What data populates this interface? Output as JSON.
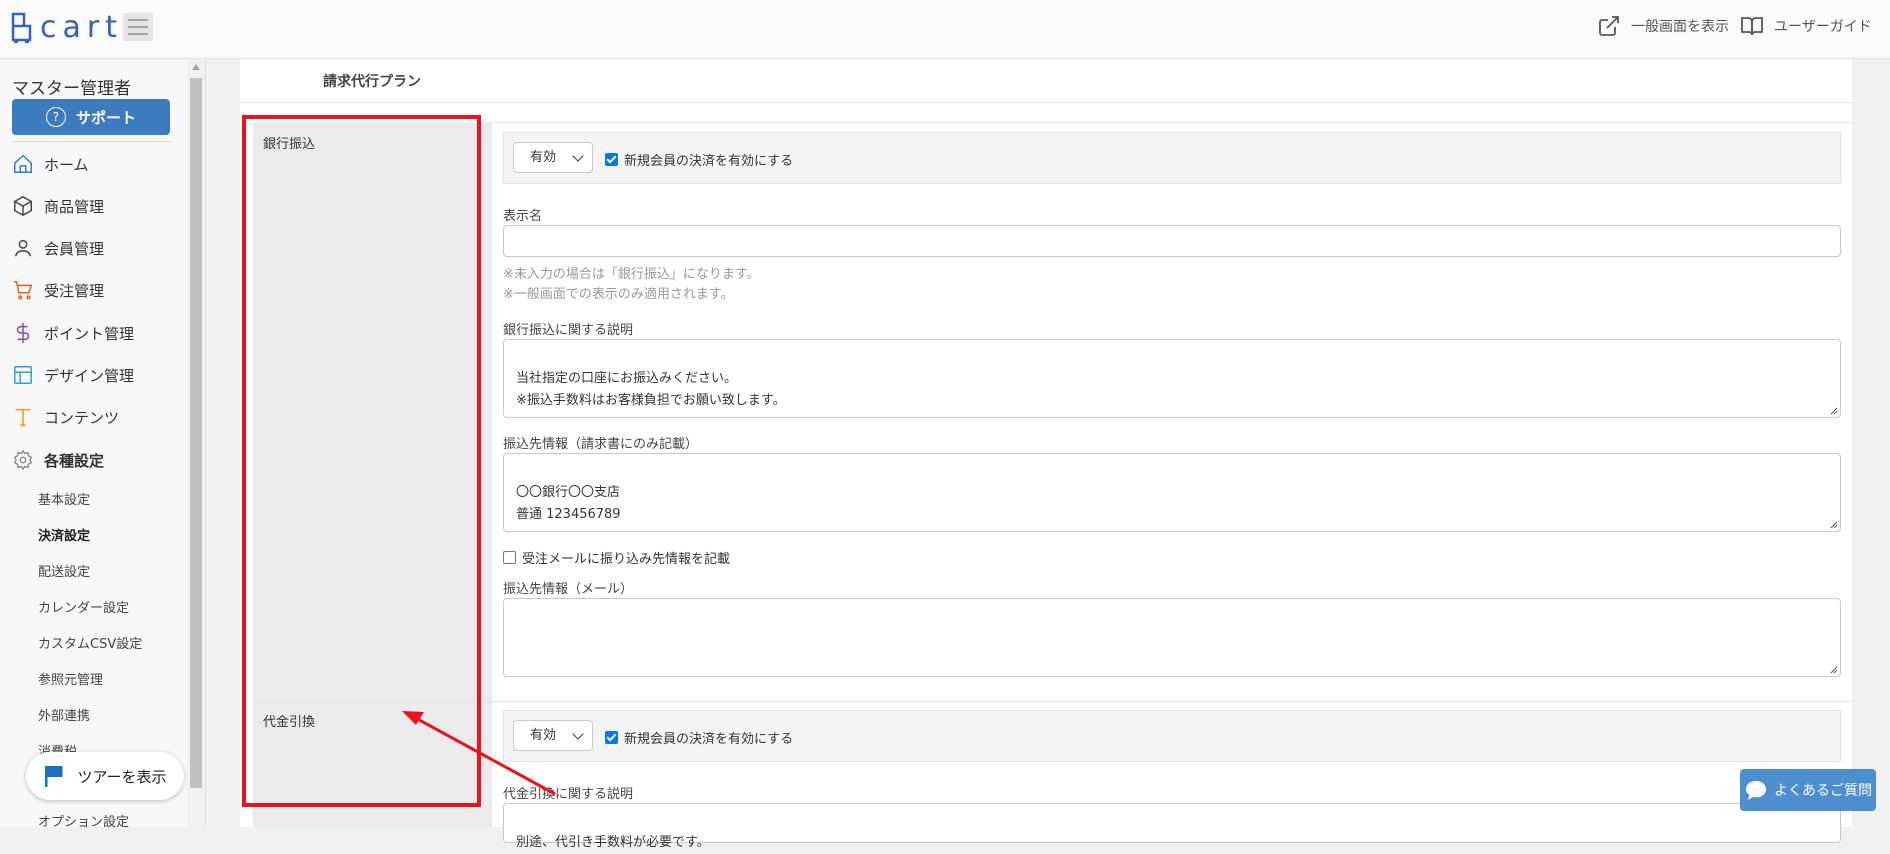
{
  "header": {
    "logo_text": "cart",
    "public_view_label": "一般画面を表示",
    "user_guide_label": "ユーザーガイド"
  },
  "sidebar": {
    "admin_title": "マスター管理者",
    "support_label": "サポート",
    "nav": [
      {
        "label": "ホーム",
        "icon": "home-icon"
      },
      {
        "label": "商品管理",
        "icon": "box-icon"
      },
      {
        "label": "会員管理",
        "icon": "user-icon"
      },
      {
        "label": "受注管理",
        "icon": "cart-icon"
      },
      {
        "label": "ポイント管理",
        "icon": "dollar-icon"
      },
      {
        "label": "デザイン管理",
        "icon": "layout-icon"
      },
      {
        "label": "コンテンツ",
        "icon": "text-icon"
      },
      {
        "label": "各種設定",
        "icon": "gear-icon"
      }
    ],
    "sub_items": [
      "基本設定",
      "決済設定",
      "配送設定",
      "カレンダー設定",
      "カスタムCSV設定",
      "参照元管理",
      "外部連携",
      "消費税",
      "オプション設定"
    ],
    "active_sub": "決済設定",
    "tour_label": "ツアーを表示"
  },
  "main": {
    "plan_label": "請求代行プラン",
    "bank": {
      "label": "銀行振込",
      "status": "有効",
      "enable_new_member_label": "新規会員の決済を有効にする",
      "enable_new_member_checked": true,
      "display_name_label": "表示名",
      "display_name_value": "",
      "note1": "※未入力の場合は「銀行振込」になります。",
      "note2": "※一般画面での表示のみ適用されます。",
      "desc_label": "銀行振込に関する説明",
      "desc_value": "当社指定の口座にお振込みください。\n※振込手数料はお客様負担でお願い致します。",
      "transfer_info_label": "振込先情報（請求書にのみ記載）",
      "transfer_info_value": "〇〇銀行〇〇支店\n普通 123456789",
      "mail_check_label": "受注メールに振り込み先情報を記載",
      "mail_check_checked": false,
      "mail_info_label": "振込先情報（メール）",
      "mail_info_value": ""
    },
    "cod": {
      "label": "代金引換",
      "status": "有効",
      "enable_new_member_label": "新規会員の決済を有効にする",
      "enable_new_member_checked": true,
      "desc_label": "代金引換に関する説明",
      "desc_value": "別途、代引き手数料が必要です。"
    }
  },
  "faq_label": "よくあるご質問",
  "colors": {
    "brand": "#3a62b0",
    "support_button": "#3d7bbf",
    "annotation": "#e8131b",
    "faq_button": "#4d8ecf"
  }
}
